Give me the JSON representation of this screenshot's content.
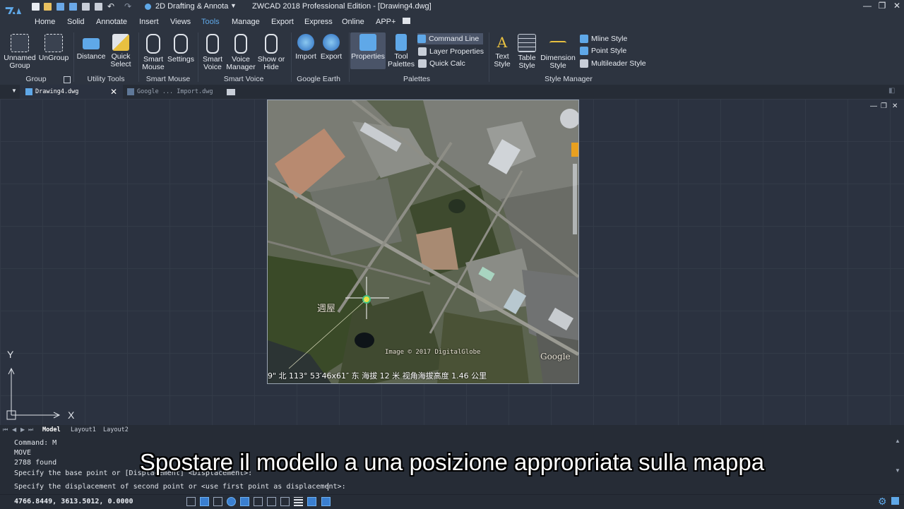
{
  "app": {
    "workspace": "2D Drafting & Annota",
    "window_title": "ZWCAD 2018 Professional Edition - [Drawing4.dwg]",
    "window_controls": [
      "—",
      "❐",
      "✕"
    ]
  },
  "menu": {
    "items": [
      "Home",
      "Solid",
      "Annotate",
      "Insert",
      "Views",
      "Tools",
      "Manage",
      "Export",
      "Express",
      "Online",
      "APP+"
    ],
    "active": "Tools"
  },
  "ribbon": {
    "groups": {
      "group": "Group",
      "utility_tools": "Utility Tools",
      "smart_mouse": "Smart Mouse",
      "smart_voice": "Smart Voice",
      "google_earth": "Google Earth",
      "palettes": "Palettes",
      "style_manager": "Style Manager"
    },
    "buttons": {
      "unnamed_group": "Unnamed Group",
      "ungroup": "UnGroup",
      "distance": "Distance",
      "quick_select": "Quick Select",
      "smart_mouse": "Smart Mouse",
      "settings": "Settings",
      "smart_voice": "Smart Voice",
      "voice_manager": "Voice Manager",
      "show_or_hide": "Show or Hide",
      "import": "Import",
      "export": "Export",
      "properties": "Properties",
      "tool_palettes": "Tool Palettes",
      "command_line": "Command Line",
      "layer_properties": "Layer Properties",
      "quick_calc": "Quick Calc",
      "text_style": "Text Style",
      "table_style": "Table Style",
      "dimension_style": "Dimension Style",
      "mline_style": "Mline Style",
      "point_style": "Point Style",
      "multileader_style": "Multileader Style"
    }
  },
  "doc_tabs": {
    "active": "Drawing4.dwg",
    "second": "Google ... Import.dwg"
  },
  "map": {
    "label_zh": "週屋",
    "copyright": "Image © 2017 DigitalGlobe",
    "google": "Google",
    "status_text": "9\" 北 113° 53′46x61″ 东 海拔    12 米   视角海拔高度   1.46 公里"
  },
  "ucs": {
    "x": "X",
    "y": "Y"
  },
  "layout_tabs": [
    "Model",
    "Layout1",
    "Layout2"
  ],
  "command": {
    "lines": [
      "Command: M",
      "MOVE",
      "2788 found",
      "Specify the base point or [Displacement] <Displacement>:"
    ],
    "prompt": "Specify the displacement of second point or <use first point as displacement>:"
  },
  "subtitle": "Spostare il modello a una posizione appropriata sulla mappa",
  "status": {
    "coords": "4766.8449, 3613.5012, 0.0000"
  },
  "colors": {
    "accent": "#5fa8e8",
    "background": "#2b3240",
    "panel": "#2d3440"
  }
}
